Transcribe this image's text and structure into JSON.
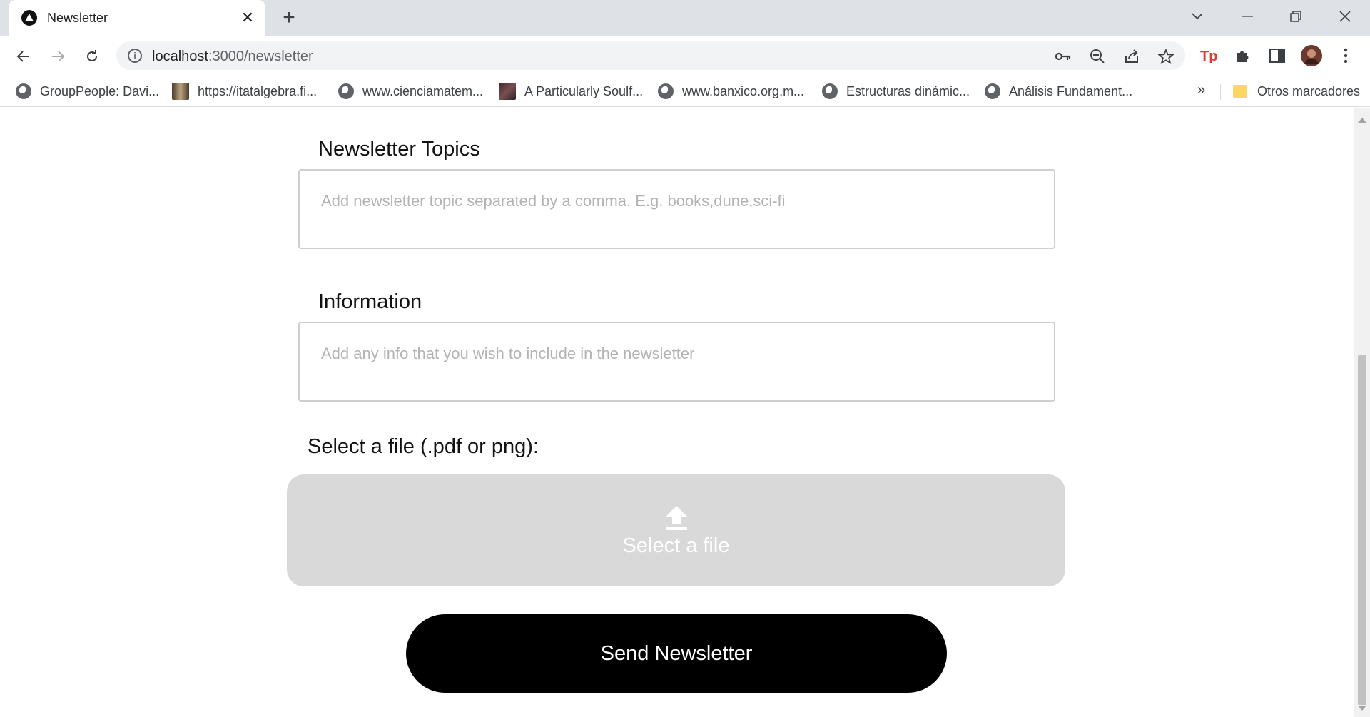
{
  "browser": {
    "tab": {
      "title": "Newsletter",
      "close_glyph": "✕"
    },
    "new_tab_glyph": "+",
    "url": {
      "host": "localhost",
      "path": ":3000/newsletter"
    },
    "bookmarks": [
      {
        "label": "GroupPeople: Davi...",
        "icon": "globe-icon"
      },
      {
        "label": "https://itatalgebra.fi...",
        "icon": "thumbnail"
      },
      {
        "label": "www.cienciamatem...",
        "icon": "globe-icon"
      },
      {
        "label": "A Particularly Soulf...",
        "icon": "thumbnail"
      },
      {
        "label": "www.banxico.org.m...",
        "icon": "globe-icon"
      },
      {
        "label": "Estructuras dinámic...",
        "icon": "globe-icon"
      },
      {
        "label": "Análisis Fundament...",
        "icon": "globe-icon"
      }
    ],
    "bookmarks_overflow": "»",
    "other_bookmarks": "Otros marcadores",
    "colors": {
      "tabstrip": "#dee1e6",
      "omnibox": "#f1f3f4",
      "extension_tp": "#e53935"
    }
  },
  "form": {
    "topics": {
      "label": "Newsletter Topics",
      "placeholder": "Add newsletter topic separated by a comma. E.g. books,dune,sci-fi",
      "value": ""
    },
    "information": {
      "label": "Information",
      "placeholder": "Add any info that you wish to include in the newsletter",
      "value": ""
    },
    "file": {
      "label": "Select a file (.pdf or png):",
      "dropzone_text": "Select a file",
      "icon": "upload-icon"
    },
    "submit_label": "Send Newsletter"
  }
}
